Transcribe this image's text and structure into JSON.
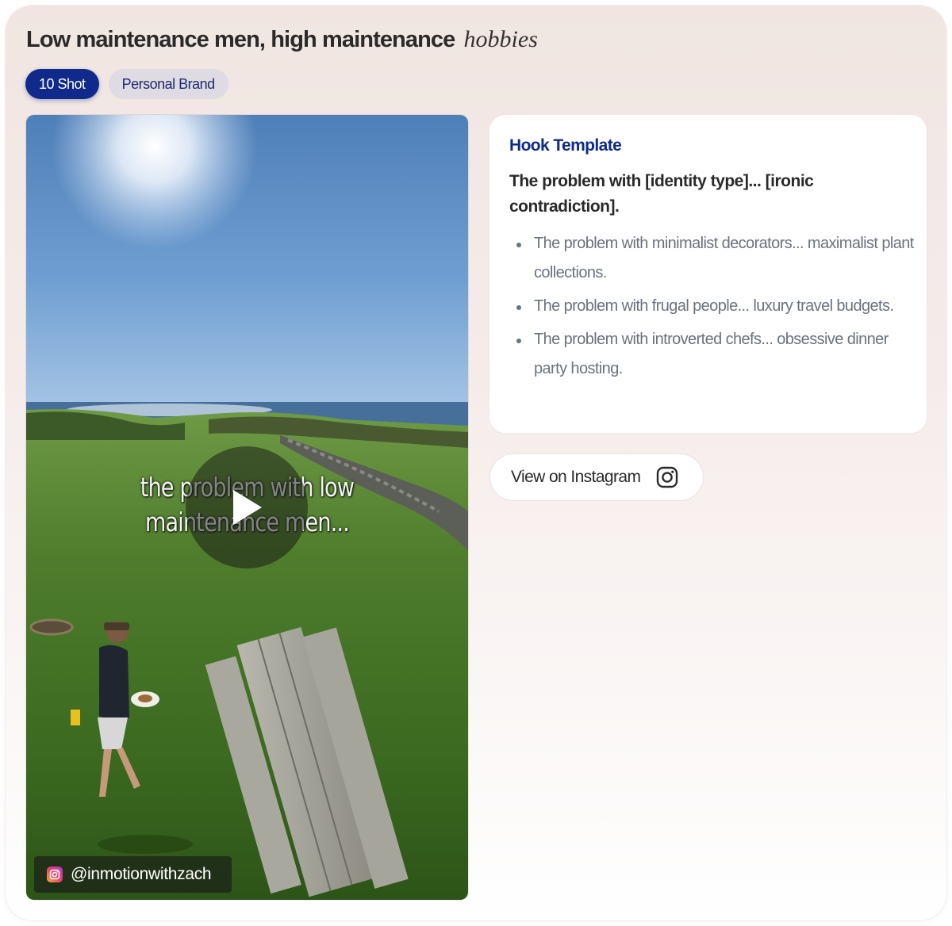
{
  "header": {
    "title_main": "Low maintenance men, high maintenance",
    "title_italic": "hobbies"
  },
  "tags": [
    {
      "label": "10 Shot",
      "active": true
    },
    {
      "label": "Personal Brand",
      "active": false
    }
  ],
  "video": {
    "caption_line1": "the problem with low",
    "caption_line2": "maintenance men...",
    "handle": "@inmotionwithzach",
    "play_icon": "play-icon"
  },
  "hook": {
    "label": "Hook Template",
    "template": "The problem with [identity type]... [ironic contradiction].",
    "examples": [
      "The problem with minimalist decorators... maximalist plant collections.",
      "The problem with frugal people... luxury travel budgets.",
      "The problem with introverted chefs... obsessive dinner party hosting."
    ]
  },
  "instagram_button": {
    "label": "View on Instagram",
    "icon": "instagram-icon"
  },
  "colors": {
    "accent": "#102a8c",
    "tag_inactive_bg": "#dfdbe3",
    "muted_text": "#6b7280"
  }
}
